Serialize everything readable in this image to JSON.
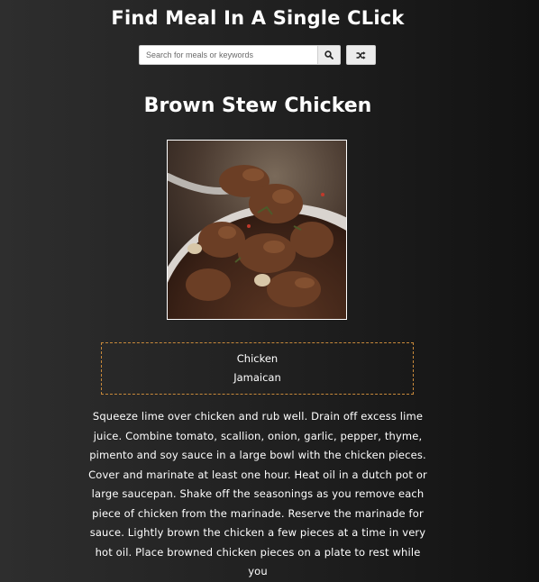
{
  "header": {
    "title": "Find Meal In A Single CLick"
  },
  "search": {
    "placeholder": "Search for meals or keywords",
    "search_icon": "search-icon",
    "random_icon": "shuffle-icon"
  },
  "meal": {
    "title": "Brown Stew Chicken",
    "category": "Chicken",
    "area": "Jamaican",
    "instructions": "Squeeze lime over chicken and rub well. Drain off excess lime juice. Combine tomato, scallion, onion, garlic, pepper, thyme, pimento and soy sauce in a large bowl with the chicken pieces. Cover and marinate at least one hour. Heat oil in a dutch pot or large saucepan. Shake off the seasonings as you remove each piece of chicken from the marinade. Reserve the marinade for sauce. Lightly brown the chicken a few pieces at a time in very hot oil. Place browned chicken pieces on a plate to rest while you"
  },
  "colors": {
    "info_border": "#c8893a",
    "text": "#ffffff"
  }
}
